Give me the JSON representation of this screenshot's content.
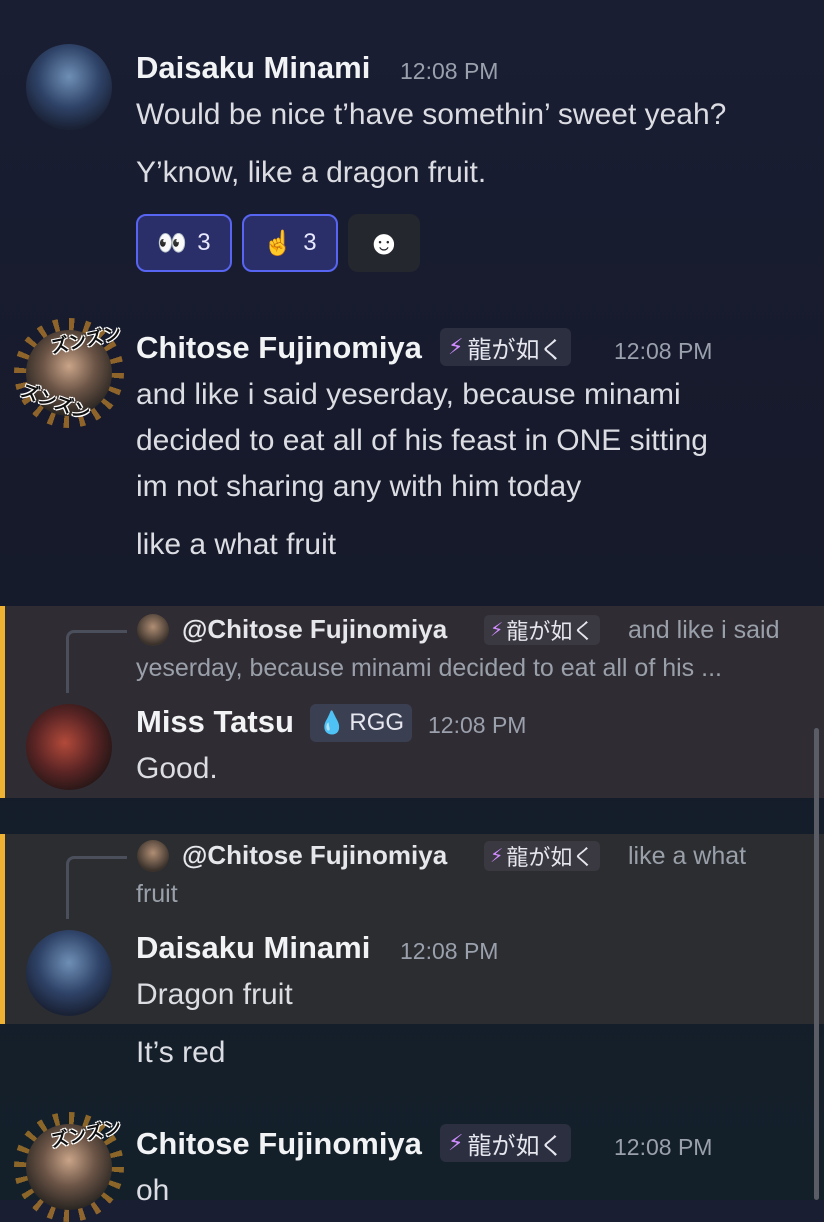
{
  "messages": {
    "m1": {
      "author": "Daisaku Minami",
      "time": "12:08 PM",
      "lines": [
        "Would be nice t’have somethin’ sweet yeah?",
        "Y’know, like a dragon fruit."
      ],
      "reactions": [
        {
          "emoji": "👀",
          "count": "3"
        },
        {
          "emoji": "☝️",
          "count": "3"
        }
      ],
      "add_reaction_icon": "☻"
    },
    "m2": {
      "author": "Chitose Fujinomiya",
      "tag_icon": "⚡",
      "tag": "龍が如く",
      "time": "12:08 PM",
      "lines": [
        "and like i said yeserday, because minami",
        "decided to eat all of his feast in ONE sitting",
        "im not sharing any with him today",
        "like a what fruit"
      ],
      "sticker_text": [
        "ズンズン",
        "ズンズン"
      ]
    },
    "m3": {
      "reply_author": "@Chitose Fujinomiya",
      "reply_tag_icon": "⚡",
      "reply_tag": "龍が如く",
      "reply_text_1": "and like i said",
      "reply_text_2": "yeserday, because minami decided to eat all of his ...",
      "author": "Miss Tatsu",
      "tag_icon": "💧",
      "tag": "RGG",
      "time": "12:08 PM",
      "text": "Good."
    },
    "m4": {
      "reply_author": "@Chitose Fujinomiya",
      "reply_tag_icon": "⚡",
      "reply_tag": "龍が如く",
      "reply_text_1": "like a what",
      "reply_text_2": "fruit",
      "author": "Daisaku Minami",
      "time": "12:08 PM",
      "text": "Dragon fruit",
      "followup": "It’s red"
    },
    "m5": {
      "author": "Chitose Fujinomiya",
      "tag_icon": "⚡",
      "tag": "龍が如く",
      "time": "12:08 PM",
      "text": "oh"
    }
  },
  "colors": {
    "reply_highlight_bar": "#f0b232",
    "reaction_active_border": "#5865f2",
    "role_icon": "#d08cff"
  }
}
